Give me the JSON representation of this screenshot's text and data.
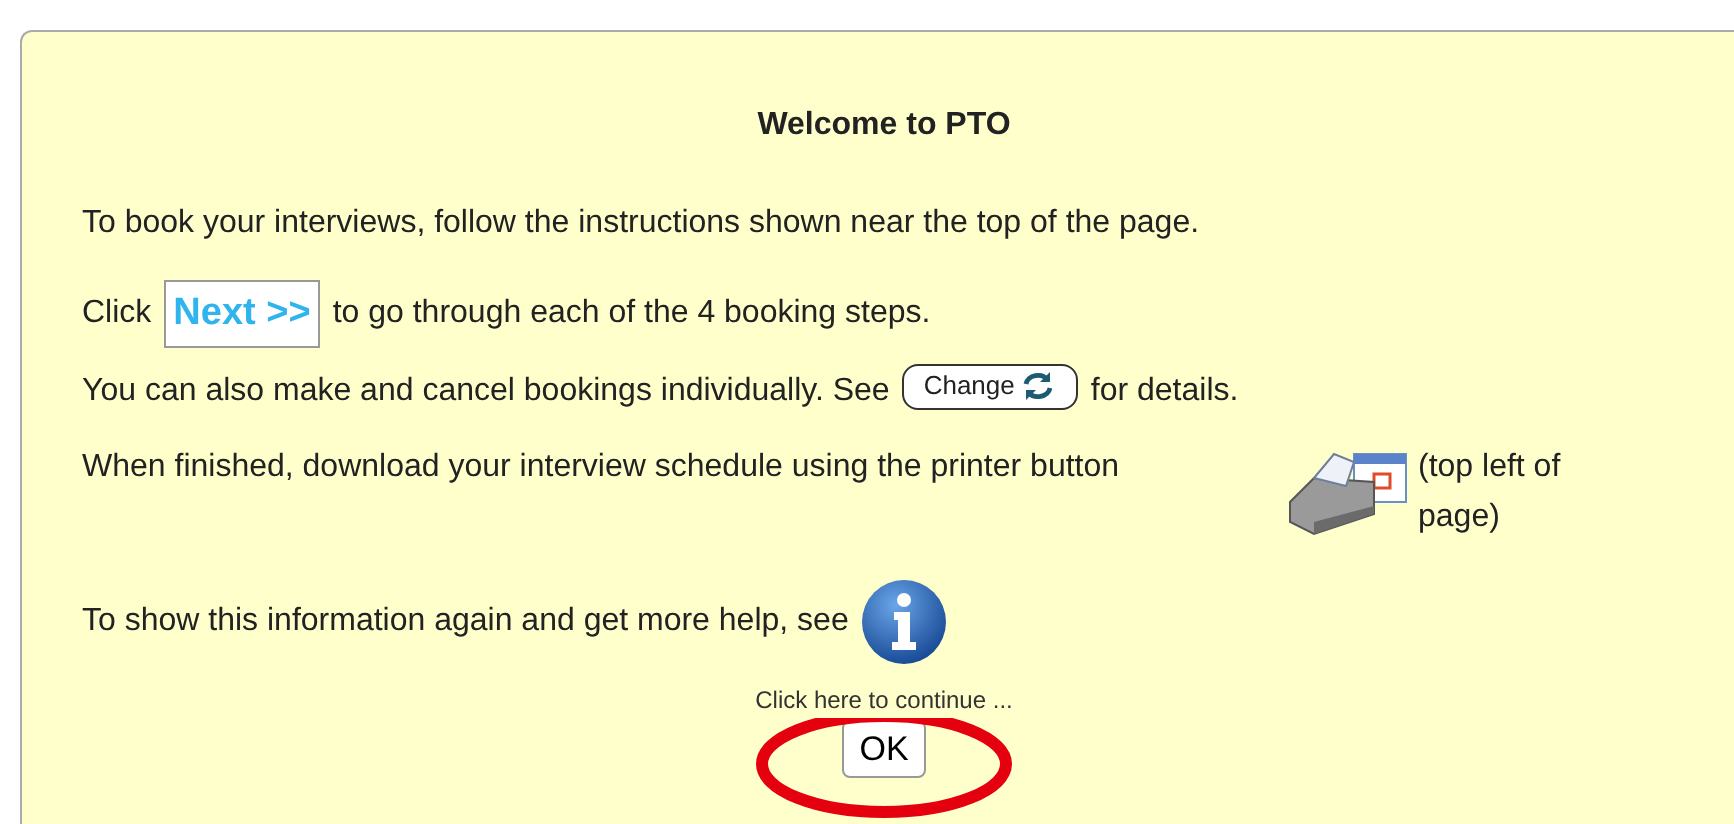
{
  "dialog": {
    "title": "Welcome to PTO",
    "lines": [
      {
        "kind": "plain",
        "text": "To book your interviews, follow the instructions shown near the top of the page."
      },
      {
        "kind": "next",
        "before": "Click",
        "button": "Next >>",
        "after": "to go through each of the 4 booking steps."
      },
      {
        "kind": "change",
        "before": "You can also make and cancel bookings individually. See",
        "button": "Change",
        "after": "for details."
      },
      {
        "kind": "printer",
        "text": "When finished, download your interview schedule using the printer button",
        "note": "(top left of page)"
      },
      {
        "kind": "info",
        "text": "To show this information again and get more help, see"
      }
    ],
    "continue": {
      "prompt": "Click here to continue ...",
      "button": "OK",
      "highlighted": true
    }
  }
}
